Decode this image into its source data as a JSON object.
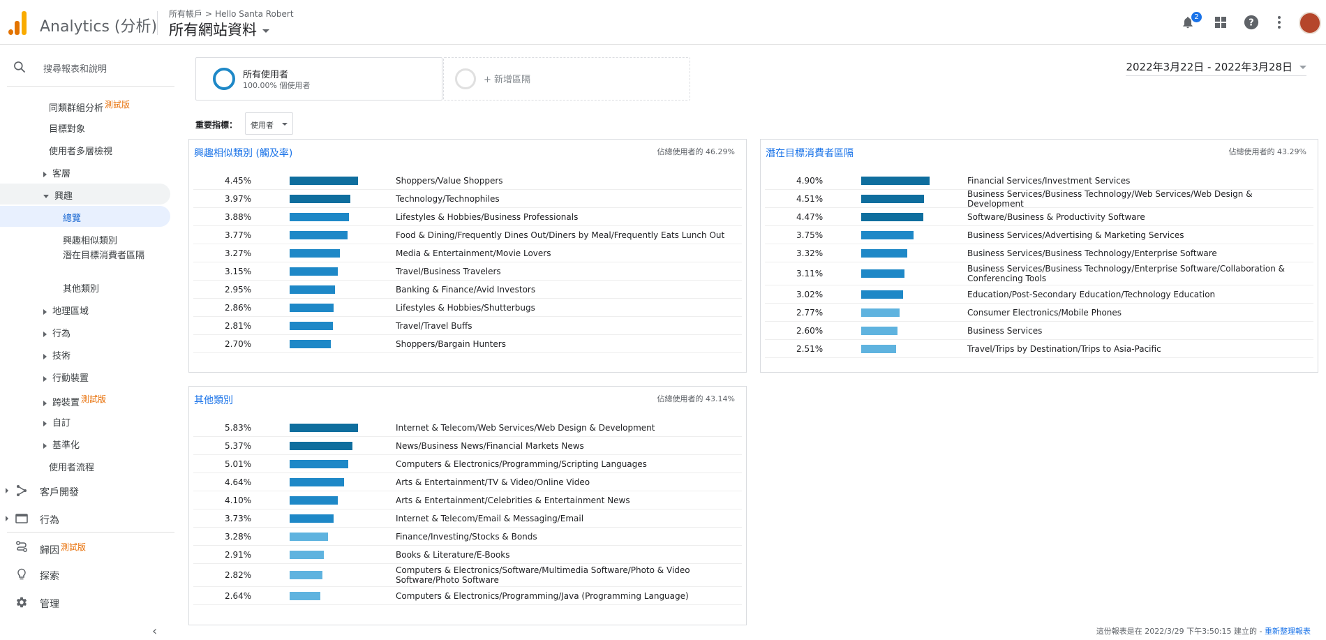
{
  "topbar": {
    "app_name": "Analytics (分析)",
    "breadcrumb": [
      "所有帳戶",
      "Hello Santa Robert"
    ],
    "property": "所有網站資料",
    "notification_count": "2",
    "icons": [
      "bell-icon",
      "apps-grid-icon",
      "help-icon",
      "more-vert-icon"
    ]
  },
  "sidebar": {
    "search_label": "搜尋報表和說明",
    "audience_items": [
      {
        "label": "同類群組分析",
        "beta": "測試版",
        "arrow": "none"
      },
      {
        "label": "目標對象",
        "arrow": "none"
      },
      {
        "label": "使用者多層檢視",
        "arrow": "none"
      },
      {
        "label": "客層",
        "arrow": "right"
      },
      {
        "label": "興趣",
        "arrow": "down"
      },
      {
        "label": "總覽",
        "arrow": "none",
        "selected": true
      },
      {
        "label": "興趣相似類別",
        "arrow": "none"
      },
      {
        "label": "潛在目標消費者區隔",
        "arrow": "none"
      },
      {
        "label": "其他類別",
        "arrow": "none"
      },
      {
        "label": "地理區域",
        "arrow": "right"
      },
      {
        "label": "行為",
        "arrow": "right"
      },
      {
        "label": "技術",
        "arrow": "right"
      },
      {
        "label": "行動裝置",
        "arrow": "right"
      },
      {
        "label": "跨裝置",
        "beta": "測試版",
        "arrow": "right"
      },
      {
        "label": "自訂",
        "arrow": "right"
      },
      {
        "label": "基準化",
        "arrow": "right"
      },
      {
        "label": "使用者流程",
        "arrow": "none"
      }
    ],
    "main_items": [
      {
        "label": "客戶開發",
        "icon": "acquisition-icon"
      },
      {
        "label": "行為",
        "icon": "behavior-icon"
      },
      {
        "label": "歸因",
        "beta": "測試版",
        "icon": "attribution-icon"
      },
      {
        "label": "探索",
        "icon": "lightbulb-icon"
      },
      {
        "label": "管理",
        "icon": "gear-icon"
      }
    ]
  },
  "segments": {
    "all_users": {
      "title": "所有使用者",
      "subtitle": "100.00% 個使用者"
    },
    "add_segment": "+ 新增區隔"
  },
  "date_range": "2022年3月22日 - 2022年3月28日",
  "metric": {
    "label": "重要指標：",
    "value": "使用者"
  },
  "panels": {
    "affinity": {
      "title": "興趣相似類別 (觸及率)",
      "share": "佔總使用者的 46.29%",
      "rows": [
        {
          "pct": "4.45%",
          "value": 4.45,
          "cat": "Shoppers/Value Shoppers"
        },
        {
          "pct": "3.97%",
          "value": 3.97,
          "cat": "Technology/Technophiles"
        },
        {
          "pct": "3.88%",
          "value": 3.88,
          "cat": "Lifestyles & Hobbies/Business Professionals"
        },
        {
          "pct": "3.77%",
          "value": 3.77,
          "cat": "Food & Dining/Frequently Dines Out/Diners by Meal/Frequently Eats Lunch Out"
        },
        {
          "pct": "3.27%",
          "value": 3.27,
          "cat": "Media & Entertainment/Movie Lovers"
        },
        {
          "pct": "3.15%",
          "value": 3.15,
          "cat": "Travel/Business Travelers"
        },
        {
          "pct": "2.95%",
          "value": 2.95,
          "cat": "Banking & Finance/Avid Investors"
        },
        {
          "pct": "2.86%",
          "value": 2.86,
          "cat": "Lifestyles & Hobbies/Shutterbugs"
        },
        {
          "pct": "2.81%",
          "value": 2.81,
          "cat": "Travel/Travel Buffs"
        },
        {
          "pct": "2.70%",
          "value": 2.7,
          "cat": "Shoppers/Bargain Hunters"
        }
      ]
    },
    "inmarket": {
      "title": "潛在目標消費者區隔",
      "share": "佔總使用者的 43.29%",
      "rows": [
        {
          "pct": "4.90%",
          "value": 4.9,
          "cat": "Financial Services/Investment Services"
        },
        {
          "pct": "4.51%",
          "value": 4.51,
          "cat": "Business Services/Business Technology/Web Services/Web Design & Development"
        },
        {
          "pct": "4.47%",
          "value": 4.47,
          "cat": "Software/Business & Productivity Software"
        },
        {
          "pct": "3.75%",
          "value": 3.75,
          "cat": "Business Services/Advertising & Marketing Services"
        },
        {
          "pct": "3.32%",
          "value": 3.32,
          "cat": "Business Services/Business Technology/Enterprise Software"
        },
        {
          "pct": "3.11%",
          "value": 3.11,
          "cat": "Business Services/Business Technology/Enterprise Software/Collaboration & Conferencing Tools"
        },
        {
          "pct": "3.02%",
          "value": 3.02,
          "cat": "Education/Post-Secondary Education/Technology Education"
        },
        {
          "pct": "2.77%",
          "value": 2.77,
          "cat": "Consumer Electronics/Mobile Phones"
        },
        {
          "pct": "2.60%",
          "value": 2.6,
          "cat": "Business Services"
        },
        {
          "pct": "2.51%",
          "value": 2.51,
          "cat": "Travel/Trips by Destination/Trips to Asia-Pacific"
        }
      ]
    },
    "other": {
      "title": "其他類別",
      "share": "佔總使用者的 43.14%",
      "rows": [
        {
          "pct": "5.83%",
          "value": 5.83,
          "cat": "Internet & Telecom/Web Services/Web Design & Development"
        },
        {
          "pct": "5.37%",
          "value": 5.37,
          "cat": "News/Business News/Financial Markets News"
        },
        {
          "pct": "5.01%",
          "value": 5.01,
          "cat": "Computers & Electronics/Programming/Scripting Languages"
        },
        {
          "pct": "4.64%",
          "value": 4.64,
          "cat": "Arts & Entertainment/TV & Video/Online Video"
        },
        {
          "pct": "4.10%",
          "value": 4.1,
          "cat": "Arts & Entertainment/Celebrities & Entertainment News"
        },
        {
          "pct": "3.73%",
          "value": 3.73,
          "cat": "Internet & Telecom/Email & Messaging/Email"
        },
        {
          "pct": "3.28%",
          "value": 3.28,
          "cat": "Finance/Investing/Stocks & Bonds"
        },
        {
          "pct": "2.91%",
          "value": 2.91,
          "cat": "Books & Literature/E-Books"
        },
        {
          "pct": "2.82%",
          "value": 2.82,
          "cat": "Computers & Electronics/Software/Multimedia Software/Photo & Video Software/Photo Software"
        },
        {
          "pct": "2.64%",
          "value": 2.64,
          "cat": "Computers & Electronics/Programming/Java (Programming Language)"
        }
      ]
    }
  },
  "footer": {
    "text": "這份報表是在 2022/3/29 下午3:50:15 建立的 - ",
    "link": "重新整理報表"
  },
  "colors": {
    "bar_dark": "#0f6e9e",
    "bar_mid": "#1e88c7",
    "bar_light": "#5fb3df",
    "link": "#1a73e8",
    "beta": "#e8710a",
    "selected_bg": "#e8f0fe",
    "section_bg": "#f1f3f4"
  }
}
